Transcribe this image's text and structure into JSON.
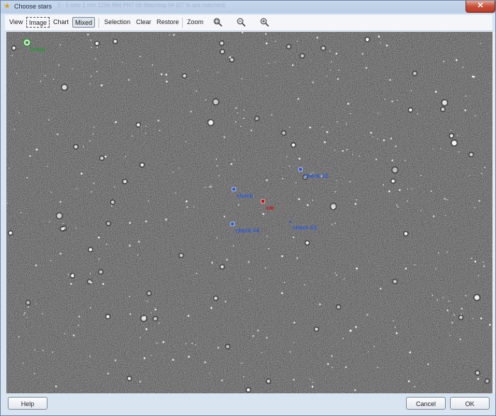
{
  "window": {
    "title": "Choose stars",
    "background_title": "1 - 5 sets   1 min 1296 984   PH7   08  Matching 04 (07 % are matched)"
  },
  "toolbar": {
    "view_label": "View",
    "image_label": "Image",
    "chart_label": "Chart",
    "mixed_label": "Mixed",
    "selection_label": "Selection",
    "clear_label": "Clear",
    "restore_label": "Restore",
    "zoom_label": "Zoom"
  },
  "canvas": {
    "markers": [
      {
        "label": "var",
        "color": "#c0141b"
      },
      {
        "label": "check",
        "color": "#2a5bd7"
      },
      {
        "label": "check #2",
        "color": "#2a5bd7"
      },
      {
        "label": "check #3",
        "color": "#2a5bd7"
      },
      {
        "label": "check #4",
        "color": "#2a5bd7"
      },
      {
        "label": "comp",
        "color": "#1f9b2a"
      }
    ]
  },
  "footer": {
    "help_label": "Help",
    "cancel_label": "Cancel",
    "ok_label": "OK"
  },
  "colors": {
    "var": "#c0141b",
    "check": "#2a5bd7",
    "comp": "#1f9b2a"
  }
}
